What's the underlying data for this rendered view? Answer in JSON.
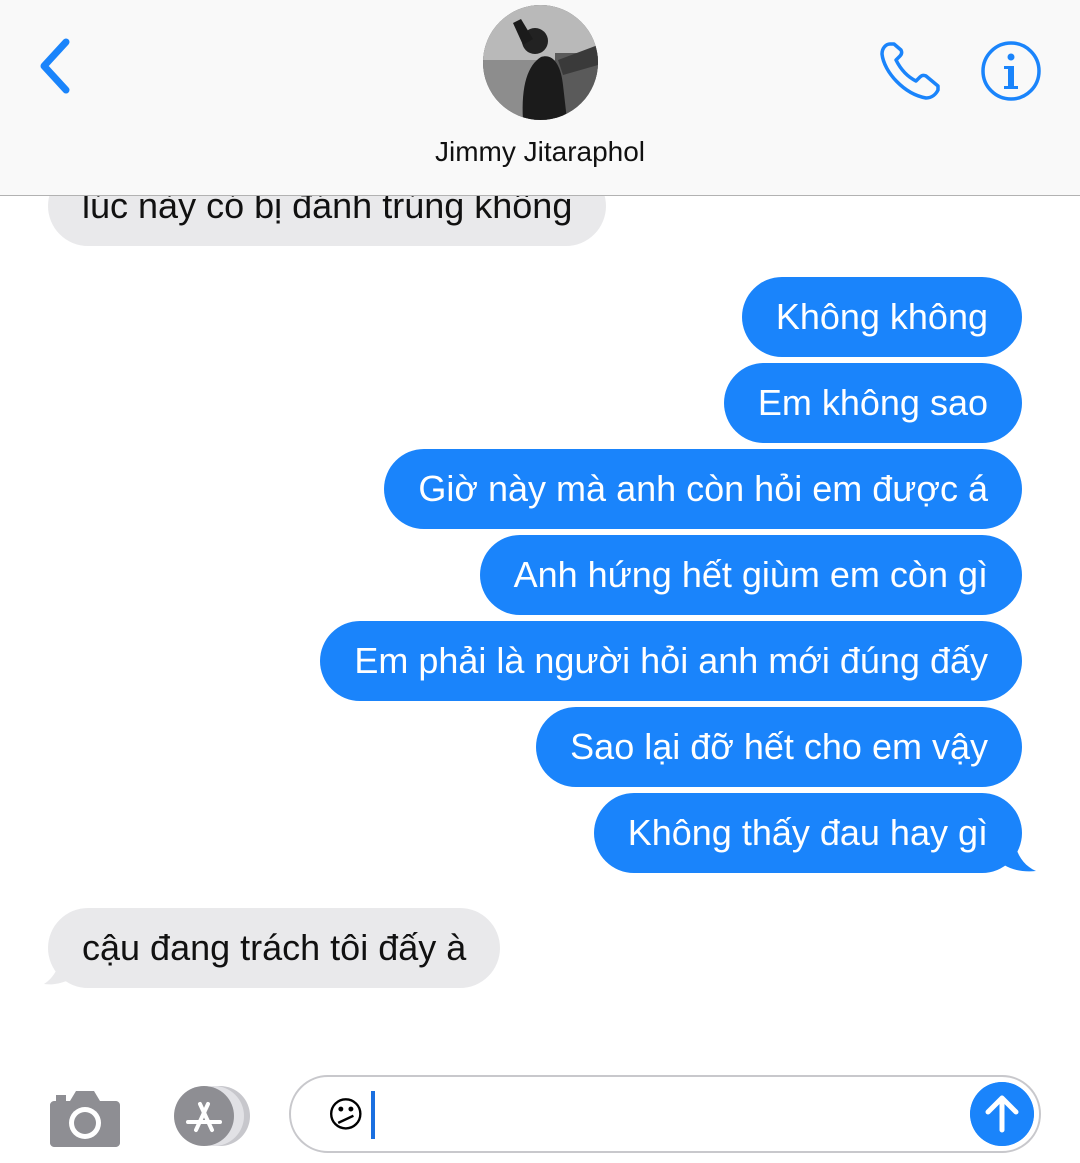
{
  "header": {
    "contact_name": "Jimmy Jitaraphol",
    "back_icon": "chevron-left-icon",
    "call_icon": "phone-icon",
    "info_icon": "info-icon"
  },
  "messages": [
    {
      "direction": "incoming",
      "text": "lúc này có bị đánh trúng không"
    },
    {
      "direction": "outgoing",
      "text": "Không không"
    },
    {
      "direction": "outgoing",
      "text": "Em không sao"
    },
    {
      "direction": "outgoing",
      "text": "Giờ này mà anh còn hỏi em được á"
    },
    {
      "direction": "outgoing",
      "text": "Anh hứng hết giùm em còn gì"
    },
    {
      "direction": "outgoing",
      "text": "Em phải là người hỏi anh mới đúng đấy"
    },
    {
      "direction": "outgoing",
      "text": "Sao lại đỡ hết cho em vậy"
    },
    {
      "direction": "outgoing",
      "text": "Không thấy đau hay gì"
    },
    {
      "direction": "incoming",
      "text": "cậu đang trách tôi đấy à"
    }
  ],
  "composer": {
    "value": "😕",
    "camera_icon": "camera-icon",
    "apps_icon": "app-store-icon",
    "send_icon": "arrow-up-icon"
  },
  "colors": {
    "accent": "#1a84fb",
    "incoming_bubble": "#e9e9eb",
    "header_bg": "#f9f9f9"
  }
}
